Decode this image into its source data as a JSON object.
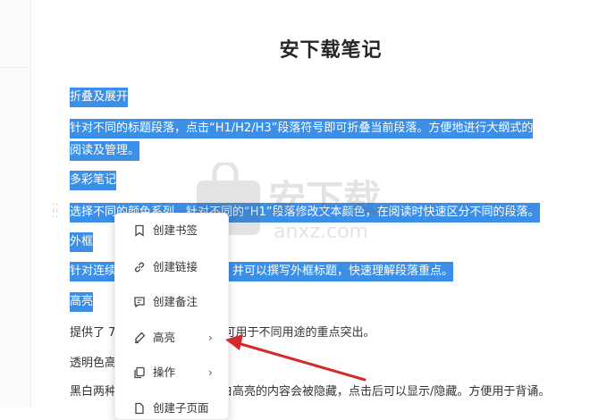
{
  "document": {
    "title": "安下载笔记",
    "lines": [
      {
        "text": "折叠及展开",
        "selected": true
      },
      {
        "text": "针对不同的标题段落，点击“H1/H2/H3”段落符号即可折叠当前段落。方便地进行大纲式的",
        "selected": true
      },
      {
        "text": "阅读及管理。",
        "selected": true
      },
      {
        "text": "多彩笔记",
        "selected": true
      },
      {
        "text": "选择不同的颜色系列，针对不同的“H1”段落修改文本颜色，在阅读时快速区分不同的段落。",
        "selected": true
      },
      {
        "text": "外框",
        "selected": true
      },
      {
        "text": "针对连续的段落进行外框总结。并可以撰写外框标题，快速理解段落重点。",
        "selected": true
      },
      {
        "text": "高亮",
        "selected": true
      },
      {
        "text": "提供了 7 种不同颜色的高亮，可用于不同用途的重点突出。",
        "selected": false
      },
      {
        "text": "透明色高亮",
        "selected": false
      },
      {
        "text": "黑白两种颜色的高亮，使用黑白高亮的内容会被隐藏，点击后可以显示/隐藏。方便用于背诵。",
        "selected": false
      }
    ]
  },
  "context_menu": {
    "items": [
      {
        "label": "创建书签",
        "icon": "bookmark-icon",
        "submenu": false
      },
      {
        "label": "创建链接",
        "icon": "link-icon",
        "submenu": false
      },
      {
        "label": "创建备注",
        "icon": "comment-icon",
        "submenu": false
      },
      {
        "label": "高亮",
        "icon": "highlighter-icon",
        "submenu": true
      },
      {
        "label": "操作",
        "icon": "copy-icon",
        "submenu": true
      },
      {
        "label": "创建子页面",
        "icon": "page-icon",
        "submenu": false
      }
    ]
  },
  "watermark": {
    "text": "安下载",
    "subtext": "anxz.com"
  },
  "colors": {
    "selection": "#3c8fe6",
    "arrow": "#d42a2a"
  }
}
